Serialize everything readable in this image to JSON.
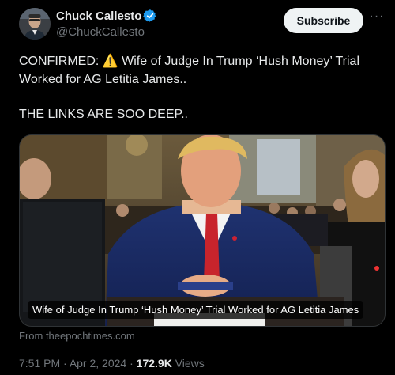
{
  "author": {
    "display_name": "Chuck Callesto",
    "handle": "@ChuckCallesto",
    "verified": true
  },
  "subscribe_label": "Subscribe",
  "more_label": "···",
  "tweet": {
    "line1_prefix": "CONFIRMED: ",
    "line1_emoji": "⚠️",
    "line1_suffix": " Wife of Judge In Trump ‘Hush Money’ Trial",
    "line2": "Worked for AG Letitia James..",
    "line3": "THE LINKS ARE SOO DEEP.."
  },
  "card": {
    "caption": "Wife of Judge In Trump ‘Hush Money’ Trial Worked for AG Letitia James",
    "source": "From theepochtimes.com"
  },
  "meta": {
    "time": "7:51 PM",
    "separator": " · ",
    "date": "Apr 2, 2024",
    "views_count": "172.9K",
    "views_label": " Views"
  },
  "colors": {
    "background": "#000000",
    "text": "#e7e9ea",
    "muted": "#71767b",
    "verified_blue": "#1d9bf0",
    "subscribe_bg": "#eff3f4"
  }
}
